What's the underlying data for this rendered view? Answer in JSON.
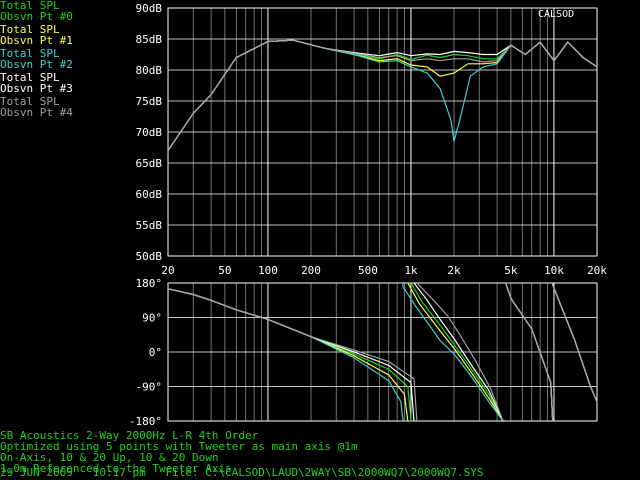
{
  "legend": [
    {
      "line1": "Total SPL",
      "line2": "Obsvn Pt #0",
      "color": "#20d020"
    },
    {
      "line1": "Total SPL",
      "line2": "Obsvn Pt #1",
      "color": "#ffff40"
    },
    {
      "line1": "Total SPL",
      "line2": "Obsvn Pt #2",
      "color": "#40d0d0"
    },
    {
      "line1": "Total SPL",
      "line2": "Obsvn Pt #3",
      "color": "#ffffff"
    },
    {
      "line1": "Total SPL",
      "line2": "Obsvn Pt #4",
      "color": "#a0a0a0"
    }
  ],
  "brand": "CALSOD",
  "info_lines": [
    "SB Acoustics 2-Way 2000Hz L-R 4th Order",
    "Optimized using 5 points with Tweeter as main axis @1m",
    "On-Axis, 10 & 20 Up, 10 & 20 Down",
    "1.0m Referenced to the Tweeter Axis"
  ],
  "footer": "29 JUN 2009   10:17 pm   File: C:\\CALSOD\\LAUD\\2WAY\\SB\\2000WQ7\\2000WQ7.SYS",
  "chart_data": [
    {
      "type": "line",
      "name": "magnitude",
      "xscale": "log",
      "xlim": [
        20,
        20000
      ],
      "ylim": [
        50,
        90
      ],
      "x_ticks": [
        20,
        50,
        100,
        200,
        500,
        1000,
        2000,
        5000,
        10000,
        20000
      ],
      "x_tick_labels": [
        "20",
        "50",
        "100",
        "200",
        "500",
        "1k",
        "2k",
        "5k",
        "10k",
        "20k"
      ],
      "y_ticks": [
        50,
        55,
        60,
        65,
        70,
        75,
        80,
        85,
        90
      ],
      "y_tick_labels": [
        "50dB",
        "55dB",
        "60dB",
        "65dB",
        "70dB",
        "75dB",
        "80dB",
        "85dB",
        "90dB"
      ],
      "grid": true,
      "series": [
        {
          "name": "Total SPL Obsvn Pt #0",
          "color": "#20d020",
          "x": [
            20,
            30,
            40,
            60,
            100,
            150,
            250,
            400,
            600,
            800,
            1000,
            1300,
            1600,
            2000,
            2500,
            3200,
            4000,
            5000,
            6300,
            8000,
            10000,
            12500,
            16000,
            20000
          ],
          "y": [
            67,
            73,
            76,
            82,
            84.6,
            84.8,
            83.5,
            82.5,
            81.8,
            82.5,
            81.7,
            82.4,
            82,
            82.5,
            82.3,
            81.8,
            81.8,
            84,
            82.5,
            84.5,
            81.5,
            84.5,
            82,
            80.5
          ]
        },
        {
          "name": "Total SPL Obsvn Pt #1",
          "color": "#ffff40",
          "x": [
            20,
            30,
            40,
            60,
            100,
            150,
            250,
            400,
            600,
            800,
            1000,
            1300,
            1600,
            2000,
            2500,
            3200,
            4000,
            5000,
            6300,
            8000,
            10000,
            12500,
            16000,
            20000
          ],
          "y": [
            67,
            73,
            76,
            82,
            84.6,
            84.8,
            83.5,
            82.5,
            81.5,
            81.8,
            80.8,
            80.5,
            79,
            79.5,
            81,
            81,
            81.2,
            84,
            82.5,
            84.5,
            81.5,
            84.5,
            82,
            80.5
          ]
        },
        {
          "name": "Total SPL Obsvn Pt #2",
          "color": "#40d0d0",
          "x": [
            20,
            30,
            40,
            60,
            100,
            150,
            250,
            400,
            600,
            800,
            1000,
            1300,
            1600,
            1900,
            2000,
            2200,
            2600,
            3200,
            4000,
            5000,
            6300,
            8000,
            10000,
            12500,
            16000,
            20000
          ],
          "y": [
            67,
            73,
            76,
            82,
            84.6,
            84.8,
            83.5,
            82.5,
            81.3,
            81.5,
            80.5,
            79.5,
            77,
            72,
            68.5,
            72,
            79,
            80.5,
            81,
            84,
            82.5,
            84.5,
            81.5,
            84.5,
            82,
            80.5
          ]
        },
        {
          "name": "Total SPL Obsvn Pt #3",
          "color": "#ffffff",
          "x": [
            20,
            30,
            40,
            60,
            100,
            150,
            250,
            400,
            600,
            800,
            1000,
            1300,
            1600,
            2000,
            2500,
            3200,
            4000,
            5000,
            6300,
            8000,
            10000,
            12500,
            16000,
            20000
          ],
          "y": [
            67,
            73,
            76,
            82,
            84.6,
            84.8,
            83.5,
            82.8,
            82.3,
            82.8,
            82.3,
            82.6,
            82.5,
            83,
            82.8,
            82.5,
            82.5,
            84,
            82.5,
            84.5,
            81.5,
            84.5,
            82,
            80.5
          ]
        },
        {
          "name": "Total SPL Obsvn Pt #4",
          "color": "#a0a0a0",
          "x": [
            20,
            30,
            40,
            60,
            100,
            150,
            250,
            400,
            600,
            800,
            1000,
            1300,
            1600,
            2000,
            2500,
            3200,
            4000,
            5000,
            6300,
            8000,
            10000,
            12500,
            16000,
            20000
          ],
          "y": [
            67,
            73,
            76,
            82,
            84.6,
            84.8,
            83.5,
            82.7,
            82,
            82.3,
            81.5,
            81.8,
            81.5,
            81.8,
            81.8,
            81.3,
            81.5,
            84,
            82.5,
            84.5,
            81.5,
            84.5,
            82,
            80.5
          ]
        }
      ]
    },
    {
      "type": "line",
      "name": "phase",
      "xscale": "log",
      "xlim": [
        20,
        20000
      ],
      "ylim": [
        -180,
        180
      ],
      "y_ticks": [
        -180,
        -90,
        0,
        90,
        180
      ],
      "y_tick_labels": [
        "-180°",
        "-90°",
        "0°",
        "90°",
        "180°"
      ],
      "grid": true,
      "series": [
        {
          "name": "Phase Obsvn Pt #0",
          "color": "#20d020",
          "x": [
            20,
            30,
            40,
            60,
            100,
            200,
            400,
            700,
            950,
            1000,
            1200,
            1600,
            2000,
            2600,
            3500,
            4400,
            4600,
            5000,
            7000,
            9500,
            9800,
            14000,
            18000,
            20000
          ],
          "y": [
            165,
            150,
            135,
            110,
            85,
            40,
            -5,
            -45,
            -90,
            180,
            130,
            70,
            20,
            -40,
            -110,
            -180,
            180,
            140,
            60,
            -80,
            175,
            30,
            -90,
            -130
          ]
        },
        {
          "name": "Phase Obsvn Pt #1",
          "color": "#ffff40",
          "x": [
            20,
            30,
            40,
            60,
            100,
            200,
            400,
            700,
            900,
            950,
            1150,
            1600,
            2000,
            2600,
            3500,
            4400,
            4600,
            5000,
            7000,
            9500,
            9800,
            14000,
            18000,
            20000
          ],
          "y": [
            165,
            150,
            135,
            110,
            85,
            40,
            -10,
            -60,
            -110,
            180,
            125,
            55,
            10,
            -50,
            -120,
            -180,
            180,
            140,
            60,
            -80,
            175,
            30,
            -90,
            -130
          ]
        },
        {
          "name": "Phase Obsvn Pt #2",
          "color": "#40d0d0",
          "x": [
            20,
            30,
            40,
            60,
            100,
            200,
            400,
            700,
            850,
            880,
            1100,
            1600,
            2000,
            2600,
            3500,
            4400,
            4600,
            5000,
            7000,
            9500,
            9800,
            14000,
            18000,
            20000
          ],
          "y": [
            165,
            150,
            135,
            110,
            85,
            40,
            -15,
            -75,
            -130,
            170,
            115,
            30,
            -5,
            -60,
            -130,
            -180,
            180,
            140,
            60,
            -80,
            175,
            30,
            -90,
            -130
          ]
        },
        {
          "name": "Phase Obsvn Pt #3",
          "color": "#ffffff",
          "x": [
            20,
            30,
            40,
            60,
            100,
            200,
            400,
            700,
            1000,
            1050,
            1300,
            1600,
            2000,
            2600,
            3500,
            4400,
            4600,
            5000,
            7000,
            9500,
            9800,
            14000,
            18000,
            20000
          ],
          "y": [
            165,
            150,
            135,
            110,
            85,
            40,
            0,
            -35,
            -80,
            180,
            135,
            85,
            35,
            -30,
            -100,
            -180,
            180,
            140,
            60,
            -80,
            175,
            30,
            -90,
            -130
          ]
        },
        {
          "name": "Phase Obsvn Pt #4",
          "color": "#a0a0a0",
          "x": [
            20,
            30,
            40,
            60,
            100,
            200,
            400,
            700,
            1050,
            1100,
            1400,
            1800,
            2200,
            2800,
            3600,
            4400,
            4600,
            5000,
            7000,
            9500,
            9800,
            14000,
            18000,
            20000
          ],
          "y": [
            165,
            150,
            135,
            110,
            85,
            40,
            5,
            -25,
            -70,
            180,
            140,
            95,
            45,
            -20,
            -95,
            -180,
            180,
            140,
            60,
            -80,
            175,
            30,
            -90,
            -130
          ]
        }
      ]
    }
  ]
}
